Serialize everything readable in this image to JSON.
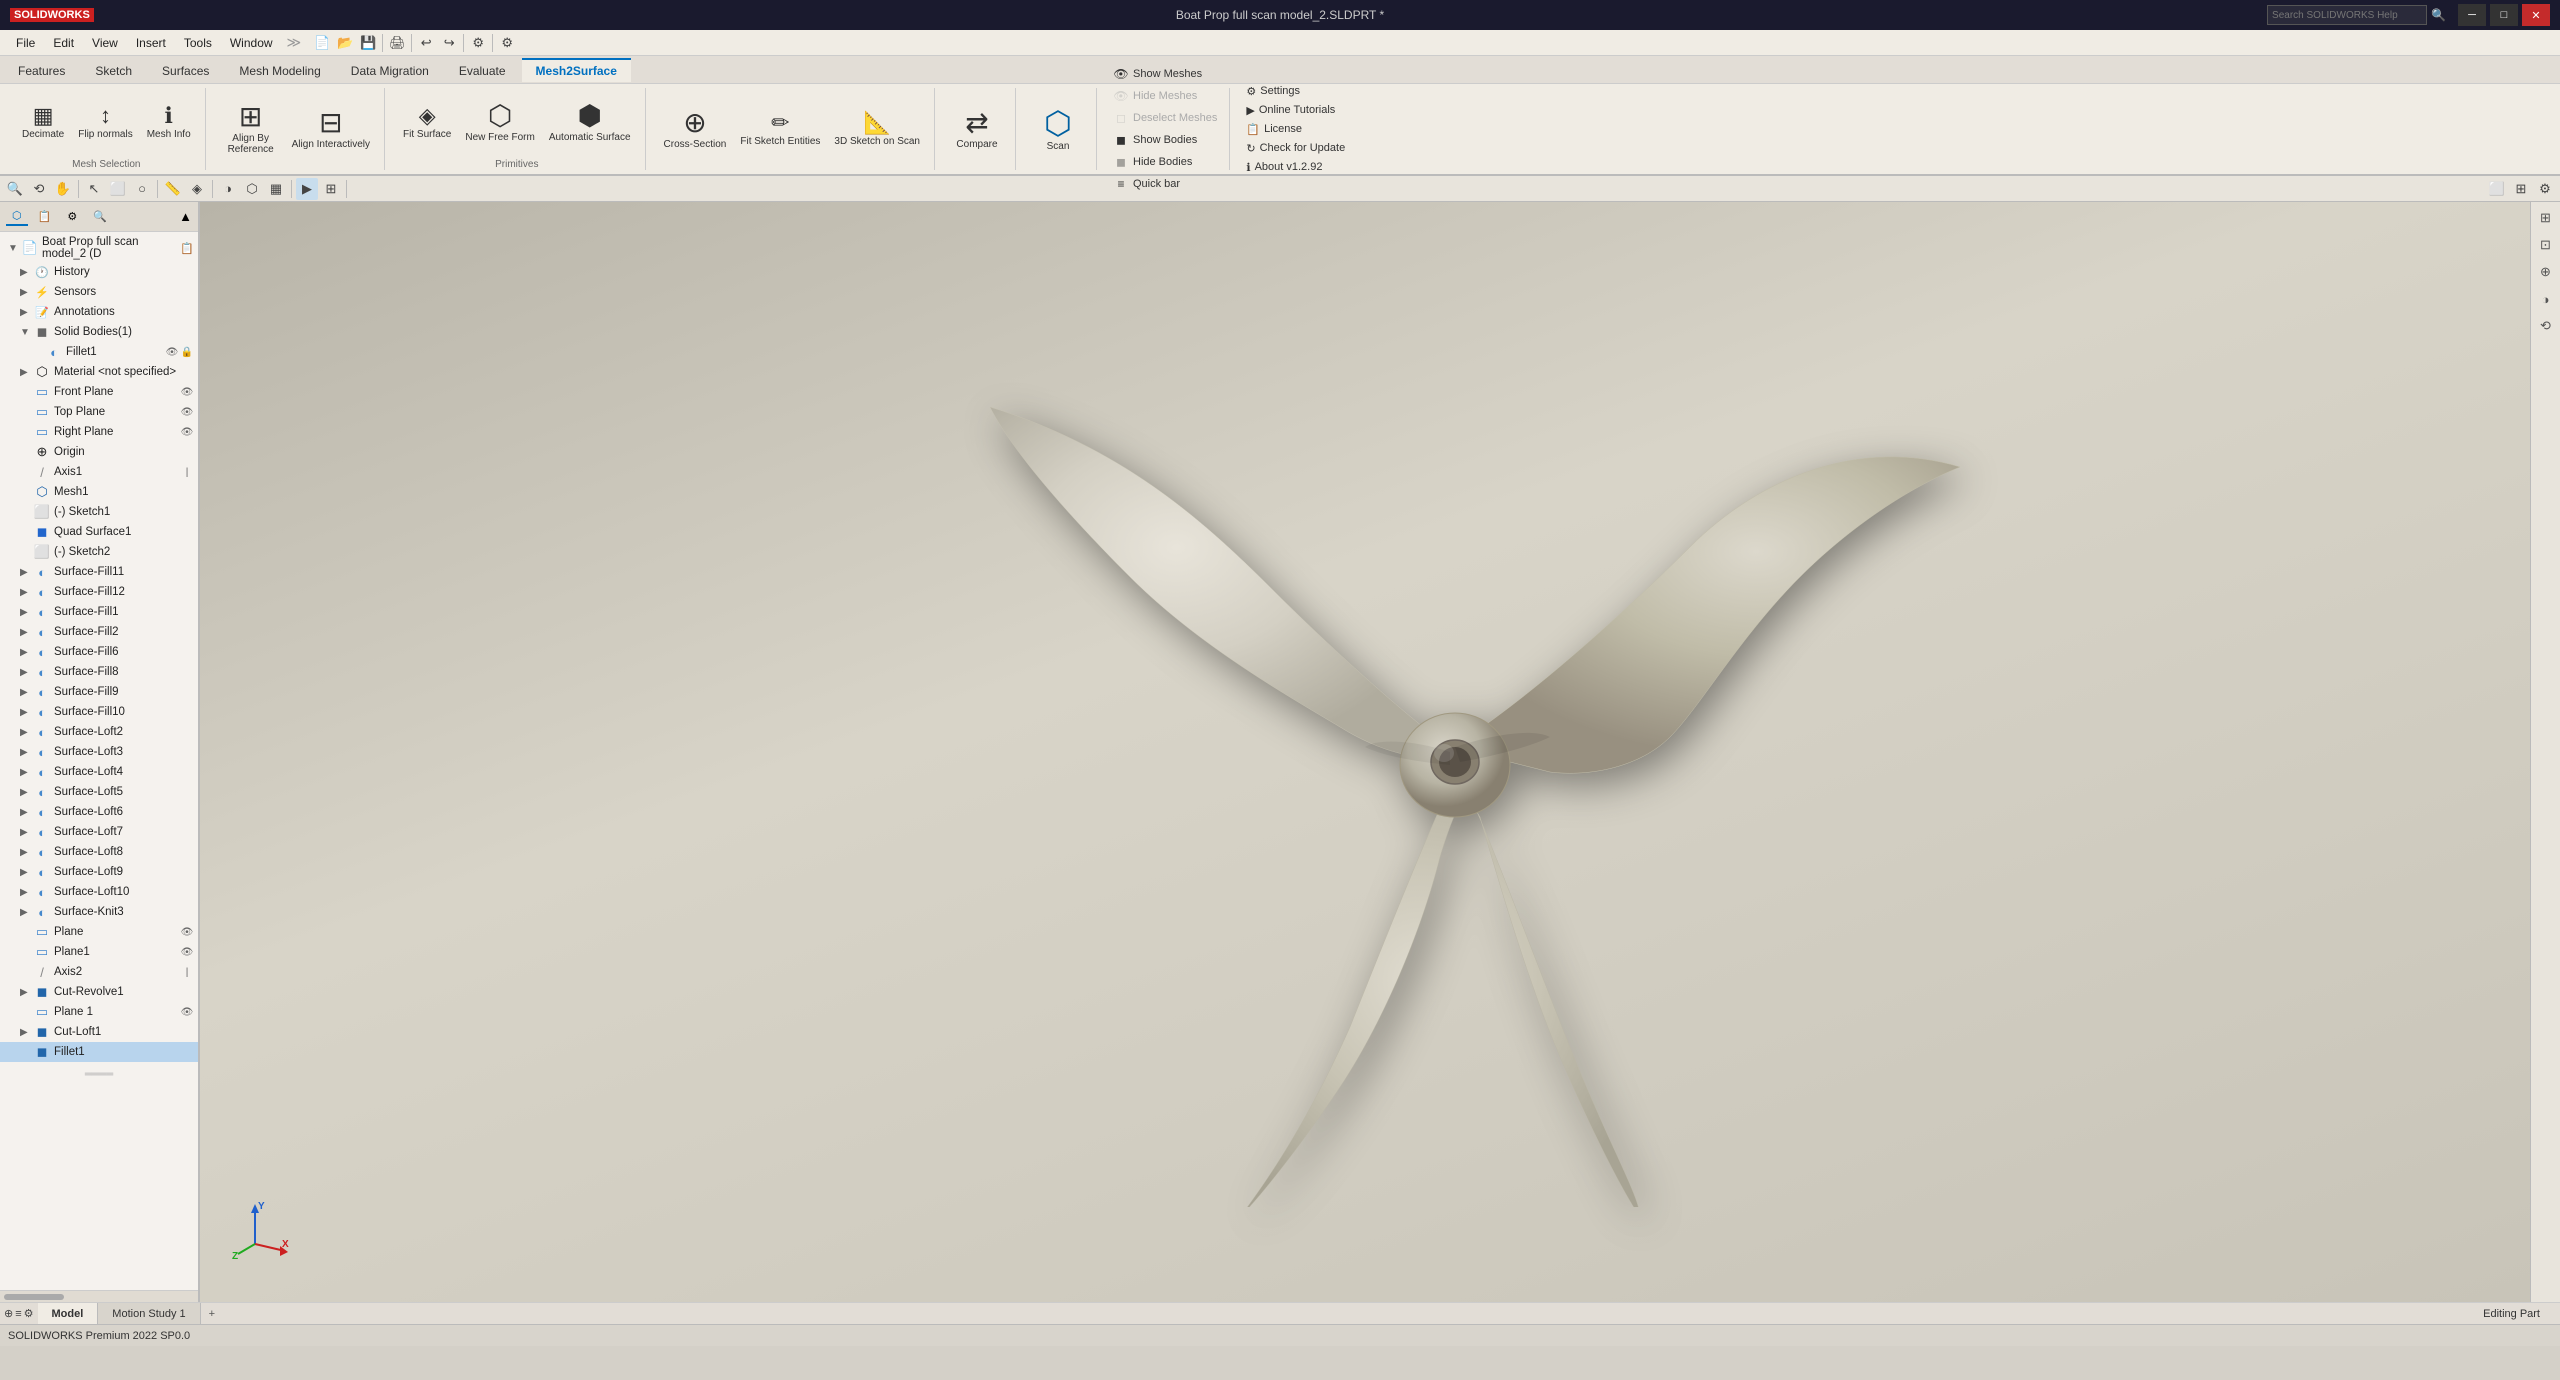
{
  "titlebar": {
    "logo": "SOLIDWORKS",
    "title": "Boat Prop full scan model_2.SLDPRT *",
    "search_placeholder": "Search SOLIDWORKS Help",
    "win_min": "─",
    "win_max": "□",
    "win_close": "✕"
  },
  "menubar": {
    "items": [
      "File",
      "Edit",
      "View",
      "Insert",
      "Tools",
      "Window"
    ]
  },
  "ribbon": {
    "tabs": [
      {
        "label": "Features",
        "active": false
      },
      {
        "label": "Sketch",
        "active": false
      },
      {
        "label": "Surfaces",
        "active": false
      },
      {
        "label": "Mesh Modeling",
        "active": false
      },
      {
        "label": "Data Migration",
        "active": false
      },
      {
        "label": "Evaluate",
        "active": false
      },
      {
        "label": "Mesh2Surface",
        "active": true
      }
    ],
    "groups": {
      "mesh_selection": {
        "label": "Mesh Selection",
        "buttons": [
          {
            "label": "Decimate",
            "icon": "▦"
          },
          {
            "label": "Normals",
            "icon": "↕"
          },
          {
            "label": "Mesh\nInfo",
            "icon": "ℹ"
          }
        ]
      },
      "align": {
        "buttons": [
          {
            "label": "Align By\nReference",
            "icon": "⊞"
          },
          {
            "label": "Align\nInteractively",
            "icon": "⊟"
          }
        ]
      },
      "primitives": {
        "label": "Primitives",
        "buttons": [
          {
            "label": "Fit\nSurface",
            "icon": "◈"
          },
          {
            "label": "New Free\nForm",
            "icon": "⬡"
          },
          {
            "label": "Automatic\nSurface",
            "icon": "⬢"
          }
        ]
      },
      "crosssection": {
        "label": "Cross-Section",
        "buttons": [
          {
            "label": "Cross-Section",
            "icon": "⊕"
          },
          {
            "label": "Fit Sketch\nEntities",
            "icon": "✏"
          },
          {
            "label": "3D Sketch\non Scan",
            "icon": "📐"
          }
        ]
      },
      "compare": {
        "label": "Compare",
        "buttons": [
          {
            "label": "Compare",
            "icon": "⇄"
          }
        ]
      }
    },
    "show_hide": {
      "show_meshes": "Show Meshes",
      "hide_meshes": "Hide Meshes",
      "deselect_meshes": "Deselect Meshes",
      "show_bodies": "Show Bodies",
      "hide_bodies": "Hide Bodies",
      "quick_bar": "Quick bar"
    },
    "settings": {
      "settings": "Settings",
      "online_tutorials": "Online Tutorials",
      "license": "License",
      "about": "About v1.2.92",
      "check_update": "Check for Update"
    }
  },
  "feature_tree": {
    "root_label": "Boat Prop full scan model_2 (D",
    "items": [
      {
        "id": "history",
        "label": "History",
        "indent": 1,
        "icon": "🕐",
        "expand": "▶"
      },
      {
        "id": "sensors",
        "label": "Sensors",
        "indent": 1,
        "icon": "📡",
        "expand": "▶"
      },
      {
        "id": "annotations",
        "label": "Annotations",
        "indent": 1,
        "icon": "📝",
        "expand": "▶"
      },
      {
        "id": "solid_bodies",
        "label": "Solid Bodies(1)",
        "indent": 1,
        "icon": "◼",
        "expand": "▼"
      },
      {
        "id": "fillet1",
        "label": "Fillet1",
        "indent": 2,
        "icon": "◐"
      },
      {
        "id": "material",
        "label": "Material <not specified>",
        "indent": 1,
        "icon": "⬡",
        "expand": "▶"
      },
      {
        "id": "front_plane",
        "label": "Front Plane",
        "indent": 1,
        "icon": "▭"
      },
      {
        "id": "top_plane",
        "label": "Top Plane",
        "indent": 1,
        "icon": "▭"
      },
      {
        "id": "right_plane",
        "label": "Right Plane",
        "indent": 1,
        "icon": "▭"
      },
      {
        "id": "origin",
        "label": "Origin",
        "indent": 1,
        "icon": "⊕"
      },
      {
        "id": "axis1",
        "label": "Axis1",
        "indent": 1,
        "icon": "/"
      },
      {
        "id": "mesh1",
        "label": "Mesh1",
        "indent": 1,
        "icon": "⬡"
      },
      {
        "id": "sketch1",
        "label": "(-) Sketch1",
        "indent": 1,
        "icon": "⬜"
      },
      {
        "id": "quad_surface1",
        "label": "Quad Surface1",
        "indent": 1,
        "icon": "◼"
      },
      {
        "id": "sketch2",
        "label": "(-) Sketch2",
        "indent": 1,
        "icon": "⬜"
      },
      {
        "id": "surface_fill11",
        "label": "Surface-Fill11",
        "indent": 1,
        "icon": "◐",
        "expand": "▶"
      },
      {
        "id": "surface_fill12",
        "label": "Surface-Fill12",
        "indent": 1,
        "icon": "◐",
        "expand": "▶"
      },
      {
        "id": "surface_fill1",
        "label": "Surface-Fill1",
        "indent": 1,
        "icon": "◐",
        "expand": "▶"
      },
      {
        "id": "surface_fill2",
        "label": "Surface-Fill2",
        "indent": 1,
        "icon": "◐",
        "expand": "▶"
      },
      {
        "id": "surface_fill6",
        "label": "Surface-Fill6",
        "indent": 1,
        "icon": "◐",
        "expand": "▶"
      },
      {
        "id": "surface_fill8",
        "label": "Surface-Fill8",
        "indent": 1,
        "icon": "◐",
        "expand": "▶"
      },
      {
        "id": "surface_fill9",
        "label": "Surface-Fill9",
        "indent": 1,
        "icon": "◐",
        "expand": "▶"
      },
      {
        "id": "surface_fill10",
        "label": "Surface-Fill10",
        "indent": 1,
        "icon": "◐",
        "expand": "▶"
      },
      {
        "id": "surface_loft2",
        "label": "Surface-Loft2",
        "indent": 1,
        "icon": "◐",
        "expand": "▶"
      },
      {
        "id": "surface_loft3",
        "label": "Surface-Loft3",
        "indent": 1,
        "icon": "◐",
        "expand": "▶"
      },
      {
        "id": "surface_loft4",
        "label": "Surface-Loft4",
        "indent": 1,
        "icon": "◐",
        "expand": "▶"
      },
      {
        "id": "surface_loft5",
        "label": "Surface-Loft5",
        "indent": 1,
        "icon": "◐",
        "expand": "▶"
      },
      {
        "id": "surface_loft6",
        "label": "Surface-Loft6",
        "indent": 1,
        "icon": "◐",
        "expand": "▶"
      },
      {
        "id": "surface_loft7",
        "label": "Surface-Loft7",
        "indent": 1,
        "icon": "◐",
        "expand": "▶"
      },
      {
        "id": "surface_loft8",
        "label": "Surface-Loft8",
        "indent": 1,
        "icon": "◐",
        "expand": "▶"
      },
      {
        "id": "surface_loft9",
        "label": "Surface-Loft9",
        "indent": 1,
        "icon": "◐",
        "expand": "▶"
      },
      {
        "id": "surface_loft10",
        "label": "Surface-Loft10",
        "indent": 1,
        "icon": "◐",
        "expand": "▶"
      },
      {
        "id": "surface_knit3",
        "label": "Surface-Knit3",
        "indent": 1,
        "icon": "◐",
        "expand": "▶"
      },
      {
        "id": "plane",
        "label": "Plane",
        "indent": 1,
        "icon": "▭"
      },
      {
        "id": "plane1",
        "label": "Plane1",
        "indent": 1,
        "icon": "▭"
      },
      {
        "id": "axis2",
        "label": "Axis2",
        "indent": 1,
        "icon": "/"
      },
      {
        "id": "cut_revolve1",
        "label": "Cut-Revolve1",
        "indent": 1,
        "icon": "◼",
        "expand": "▶"
      },
      {
        "id": "plane_1",
        "label": "Plane 1",
        "indent": 1,
        "icon": "▭"
      },
      {
        "id": "cut_loft1",
        "label": "Cut-Loft1",
        "indent": 1,
        "icon": "◼",
        "expand": "▶"
      },
      {
        "id": "fillet1_2",
        "label": "Fillet1",
        "indent": 1,
        "icon": "◐",
        "selected": true
      }
    ]
  },
  "viewport": {
    "background_top": "#b0aca0",
    "background_bottom": "#c8c4b8"
  },
  "bottom": {
    "tabs": [
      "Model",
      "Motion Study 1"
    ],
    "active_tab": "Model",
    "status": "SOLIDWORKS Premium 2022 SP0.0",
    "editing": "Editing Part"
  },
  "small_toolbar": {
    "buttons": [
      "⊕",
      "⟲",
      "⟳",
      "▶",
      "⏹",
      "□",
      "○",
      "⬡",
      "▦",
      "⬢",
      "⟵",
      "→",
      "↩",
      "↪",
      "🔍",
      "◈",
      "⊕",
      "⊙",
      "⊞",
      "◉"
    ]
  }
}
